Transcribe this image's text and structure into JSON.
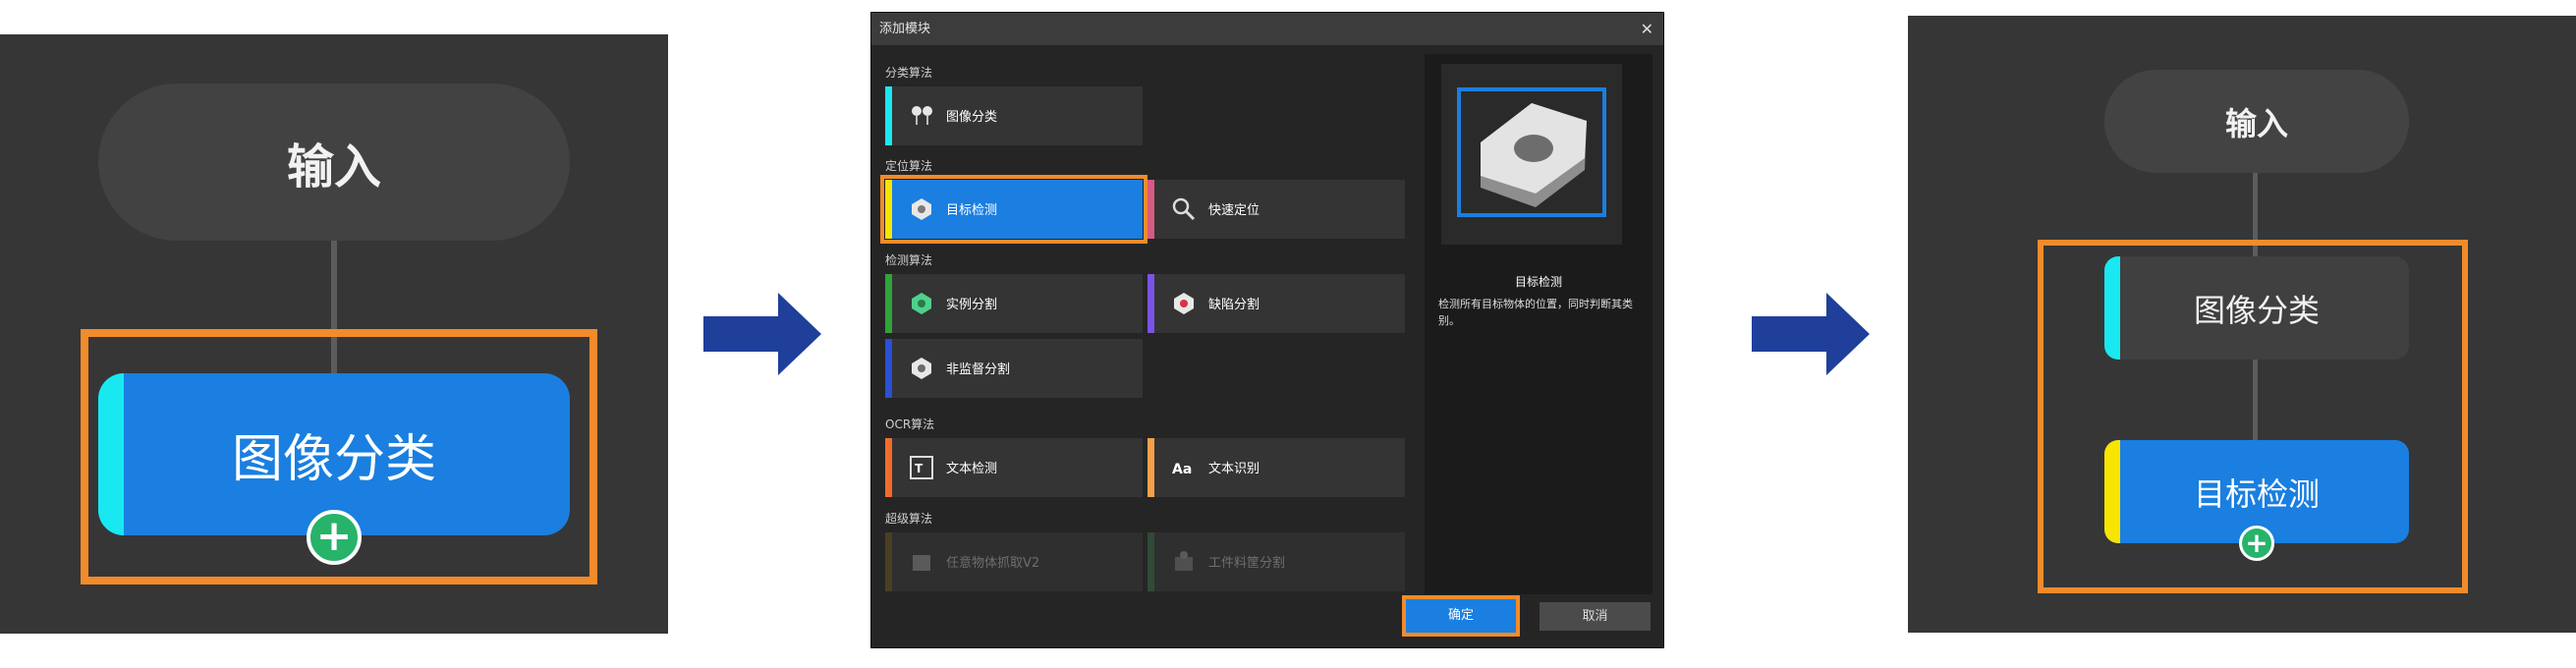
{
  "colors": {
    "accent_blue": "#1a7fe0",
    "highlight_orange": "#f28b2a",
    "arrow_blue": "#1f3f9b",
    "bar_cyan": "#19e8f0",
    "bar_yellow": "#f7e400",
    "plus_green": "#27b36a"
  },
  "left_panel": {
    "input_node": "输入",
    "classify_node": "图像分类",
    "add_icon": "plus-circle-icon"
  },
  "dialog": {
    "title": "添加模块",
    "close_icon": "close-icon",
    "categories": [
      {
        "label": "分类算法",
        "modules": [
          {
            "label": "图像分类",
            "icon": "image-classify-icon",
            "bar": "#19e8f0"
          }
        ]
      },
      {
        "label": "定位算法",
        "modules": [
          {
            "label": "目标检测",
            "icon": "object-detection-icon",
            "bar": "#f7e400",
            "selected": true
          },
          {
            "label": "快速定位",
            "icon": "fast-locate-icon",
            "bar": "#d65b7f"
          }
        ]
      },
      {
        "label": "检测算法",
        "modules": [
          {
            "label": "实例分割",
            "icon": "instance-segmentation-icon",
            "bar": "#2ea43a"
          },
          {
            "label": "缺陷分割",
            "icon": "defect-segmentation-icon",
            "bar": "#7a53e6"
          },
          {
            "label": "非监督分割",
            "icon": "unsupervised-segmentation-icon",
            "bar": "#2b4fd6"
          }
        ]
      },
      {
        "label": "OCR算法",
        "modules": [
          {
            "label": "文本检测",
            "icon": "text-detection-icon",
            "bar": "#f26b2a"
          },
          {
            "label": "文本识别",
            "icon": "text-recognition-icon",
            "bar": "#f5a04a"
          }
        ]
      },
      {
        "label": "超级算法",
        "modules": [
          {
            "label": "任意物体抓取V2",
            "icon": "object-grasp-icon",
            "bar": "#4a3f22",
            "disabled": true
          },
          {
            "label": "工件料筐分割",
            "icon": "workpiece-bin-icon",
            "bar": "#2f4a37",
            "disabled": true
          }
        ]
      }
    ],
    "preview": {
      "image": "hex-nut-icon",
      "title": "目标检测",
      "description": "检测所有目标物体的位置，同时判断其类别。"
    },
    "ok_label": "确定",
    "cancel_label": "取消"
  },
  "right_panel": {
    "input_node": "输入",
    "classify_node": "图像分类",
    "detection_node": "目标检测",
    "add_icon": "plus-circle-icon"
  }
}
